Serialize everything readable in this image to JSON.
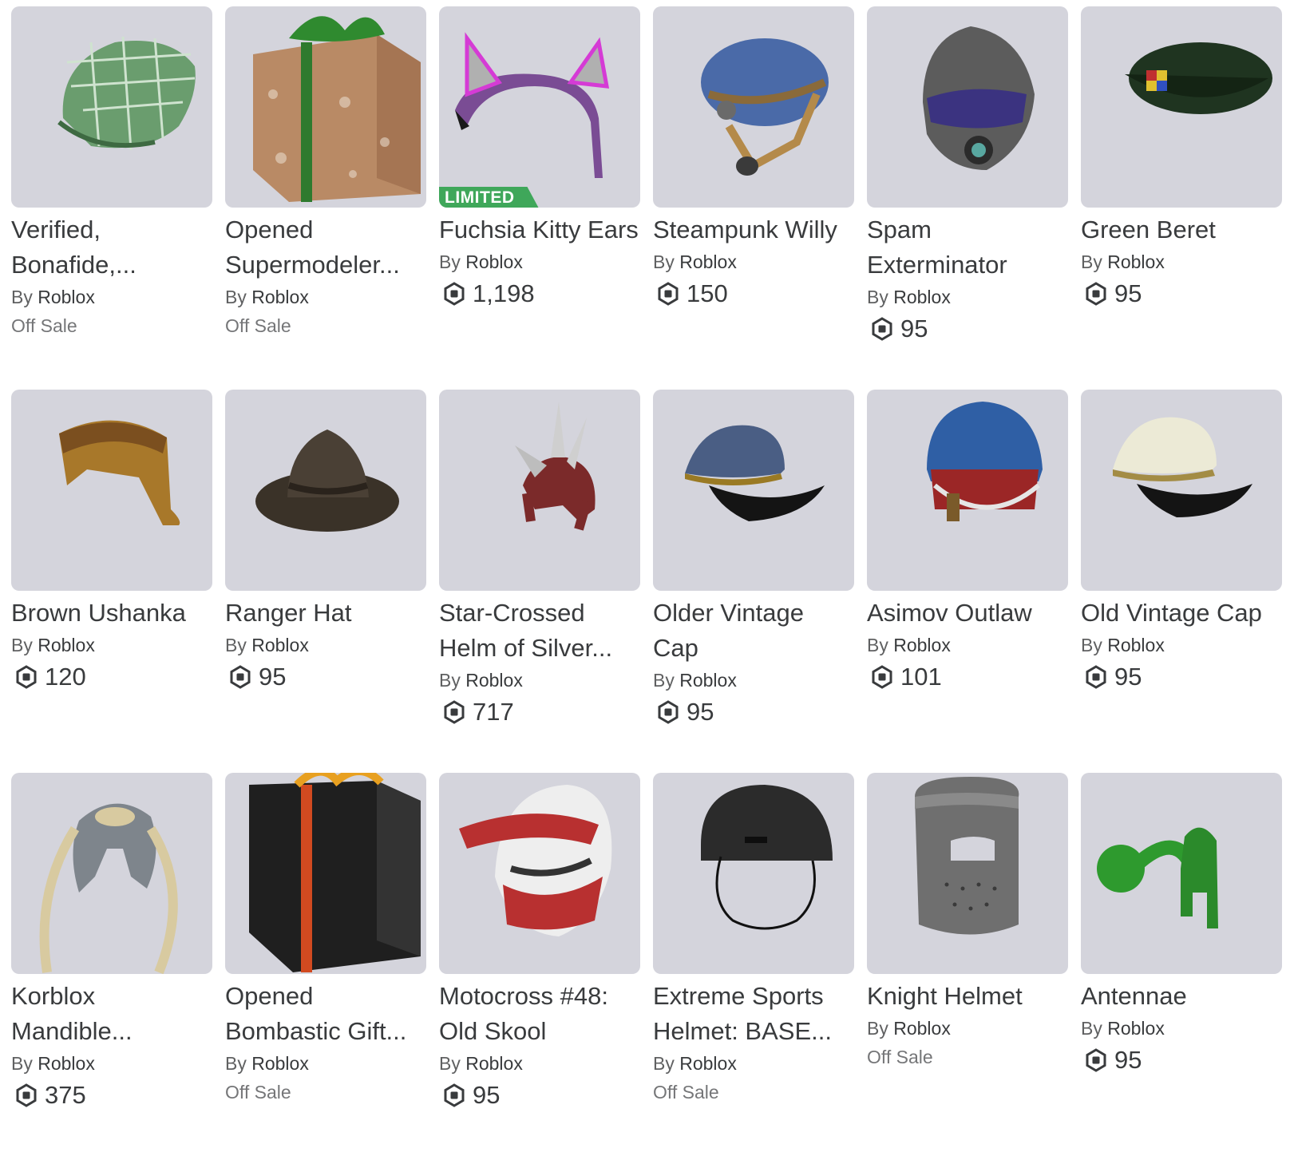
{
  "items": [
    {
      "name": "Verified, Bonafide,...",
      "by": "By",
      "creator": "Roblox",
      "price": "",
      "status": "Off Sale",
      "limited": "",
      "art": "green-plaid-cap",
      "thumb_bg": "#d4d4dc"
    },
    {
      "name": "Opened Supermodeler...",
      "by": "By",
      "creator": "Roblox",
      "price": "",
      "status": "Off Sale",
      "limited": "",
      "art": "brown-gift-box",
      "thumb_bg": "#d4d4dc"
    },
    {
      "name": "Fuchsia Kitty Ears",
      "by": "By",
      "creator": "Roblox",
      "price": "1,198",
      "status": "",
      "limited": "LIMITED",
      "art": "kitty-ears",
      "thumb_bg": "#d4d4dc"
    },
    {
      "name": "Steampunk Willy",
      "by": "By",
      "creator": "Roblox",
      "price": "150",
      "status": "",
      "limited": "",
      "art": "steampunk-hat",
      "thumb_bg": "#d4d4dc"
    },
    {
      "name": "Spam Exterminator",
      "by": "By",
      "creator": "Roblox",
      "price": "95",
      "status": "",
      "limited": "",
      "art": "gas-mask-helmet",
      "thumb_bg": "#d4d4dc"
    },
    {
      "name": "Green Beret",
      "by": "By",
      "creator": "Roblox",
      "price": "95",
      "status": "",
      "limited": "",
      "art": "green-beret",
      "thumb_bg": "#d4d4dc"
    },
    {
      "name": "Brown Ushanka",
      "by": "By",
      "creator": "Roblox",
      "price": "120",
      "status": "",
      "limited": "",
      "art": "ushanka",
      "thumb_bg": "#d4d4dc"
    },
    {
      "name": "Ranger Hat",
      "by": "By",
      "creator": "Roblox",
      "price": "95",
      "status": "",
      "limited": "",
      "art": "ranger-hat",
      "thumb_bg": "#d4d4dc"
    },
    {
      "name": "Star-Crossed Helm of Silver...",
      "by": "By",
      "creator": "Roblox",
      "price": "717",
      "status": "",
      "limited": "",
      "art": "spiked-helm",
      "thumb_bg": "#d4d4dc"
    },
    {
      "name": "Older Vintage Cap",
      "by": "By",
      "creator": "Roblox",
      "price": "95",
      "status": "",
      "limited": "",
      "art": "blue-cap",
      "thumb_bg": "#d4d4dc"
    },
    {
      "name": "Asimov Outlaw",
      "by": "By",
      "creator": "Roblox",
      "price": "101",
      "status": "",
      "limited": "",
      "art": "asimov-helmet",
      "thumb_bg": "#d4d4dc"
    },
    {
      "name": "Old Vintage Cap",
      "by": "By",
      "creator": "Roblox",
      "price": "95",
      "status": "",
      "limited": "",
      "art": "white-cap",
      "thumb_bg": "#d4d4dc"
    },
    {
      "name": "Korblox Mandible...",
      "by": "By",
      "creator": "Roblox",
      "price": "375",
      "status": "",
      "limited": "",
      "art": "korblox-mandible",
      "thumb_bg": "#d4d4dc"
    },
    {
      "name": "Opened Bombastic Gift...",
      "by": "By",
      "creator": "Roblox",
      "price": "",
      "status": "Off Sale",
      "limited": "",
      "art": "black-gift-box",
      "thumb_bg": "#d4d4dc"
    },
    {
      "name": "Motocross #48: Old Skool",
      "by": "By",
      "creator": "Roblox",
      "price": "95",
      "status": "",
      "limited": "",
      "art": "motocross-helmet",
      "thumb_bg": "#d4d4dc"
    },
    {
      "name": "Extreme Sports Helmet: BASE...",
      "by": "By",
      "creator": "Roblox",
      "price": "",
      "status": "Off Sale",
      "limited": "",
      "art": "sports-helmet",
      "thumb_bg": "#d4d4dc"
    },
    {
      "name": "Knight Helmet",
      "by": "By",
      "creator": "Roblox",
      "price": "",
      "status": "Off Sale",
      "limited": "",
      "art": "knight-helmet",
      "thumb_bg": "#d4d4dc"
    },
    {
      "name": "Antennae",
      "by": "By",
      "creator": "Roblox",
      "price": "95",
      "status": "",
      "limited": "",
      "art": "antennae",
      "thumb_bg": "#d4d4dc"
    }
  ],
  "robux_icon": "robux-icon",
  "colors": {
    "limited_badge": "#3fa75a",
    "thumb_bg": "#d4d4dc",
    "text": "#393b3d",
    "muted": "#757678"
  }
}
